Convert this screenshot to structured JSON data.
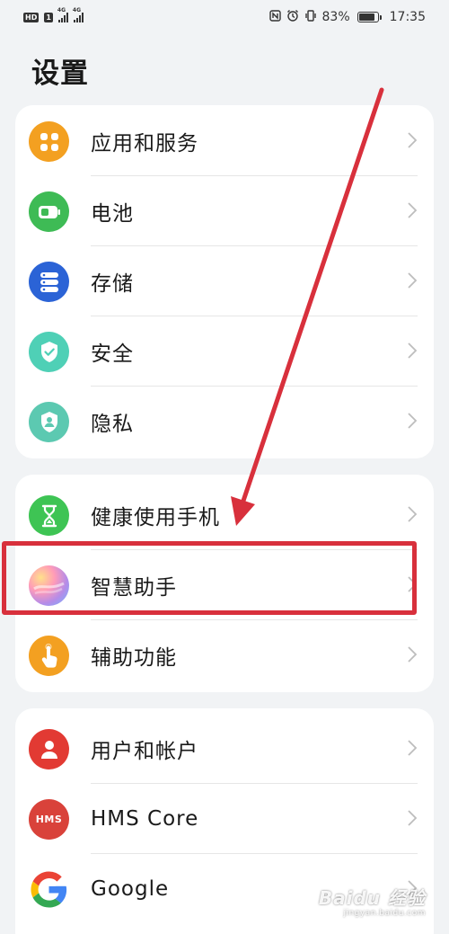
{
  "statusbar": {
    "hd": "HD",
    "sim1": "1",
    "net1": "4G",
    "net2": "4G",
    "battery_pct": "83%",
    "time": "17:35",
    "icons": [
      "nfc-icon",
      "alarm-icon",
      "vibrate-icon",
      "battery-icon"
    ]
  },
  "page": {
    "title": "设置"
  },
  "groups": [
    {
      "items": [
        {
          "label": "应用和服务",
          "icon": "apps-services-icon",
          "color": "#f3a021"
        },
        {
          "label": "电池",
          "icon": "battery-icon",
          "color": "#3ebb55"
        },
        {
          "label": "存储",
          "icon": "storage-icon",
          "color": "#2b63d6"
        },
        {
          "label": "安全",
          "icon": "security-shield-icon",
          "color": "#4fd0b6"
        },
        {
          "label": "隐私",
          "icon": "privacy-icon",
          "color": "#5cc9b1"
        }
      ]
    },
    {
      "items": [
        {
          "label": "健康使用手机",
          "icon": "hourglass-icon",
          "color": "#3ec454"
        },
        {
          "label": "智慧助手",
          "icon": "assistant-orb-icon",
          "color": "#b58ce8"
        },
        {
          "label": "辅助功能",
          "icon": "accessibility-hand-icon",
          "color": "#f3a021"
        }
      ]
    },
    {
      "items": [
        {
          "label": "用户和帐户",
          "icon": "user-icon",
          "color": "#e23a33"
        },
        {
          "label": "HMS Core",
          "icon": "hms-icon",
          "color": "#d9423a",
          "badge": "HMS"
        },
        {
          "label": "Google",
          "icon": "google-icon",
          "color": "#ffffff"
        }
      ]
    }
  ],
  "annotation": {
    "arrow_color": "#d8303c",
    "highlight_target": "智慧助手"
  },
  "watermark": {
    "brand": "Baidu 经验",
    "url": "jingyan.baidu.com"
  }
}
